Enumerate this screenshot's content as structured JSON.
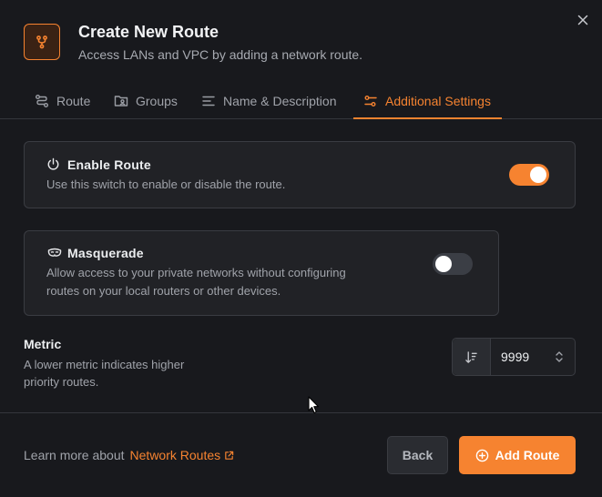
{
  "dialog": {
    "title": "Create New Route",
    "subtitle": "Access LANs and VPC by adding a network route.",
    "header_icon": "route-icon",
    "close_icon": "close-icon"
  },
  "tabs": [
    {
      "label": "Route",
      "icon": "route-icon",
      "active": false
    },
    {
      "label": "Groups",
      "icon": "groups-folder-icon",
      "active": false
    },
    {
      "label": "Name & Description",
      "icon": "text-lines-icon",
      "active": false
    },
    {
      "label": "Additional Settings",
      "icon": "settings-sliders-icon",
      "active": true
    }
  ],
  "enable_route": {
    "title": "Enable Route",
    "description": "Use this switch to enable or disable the route.",
    "icon": "power-icon",
    "enabled": true
  },
  "masquerade": {
    "title": "Masquerade",
    "description_line1": "Allow access to your private networks without configuring",
    "description_line2": "routes on your local routers or other devices.",
    "icon": "mask-icon",
    "enabled": false
  },
  "metric": {
    "title": "Metric",
    "description_line1": "A lower metric indicates higher",
    "description_line2": "priority routes.",
    "value": "9999",
    "prefix_icon": "sort-descending-icon",
    "stepper_icon": "chevron-up-down-icon"
  },
  "footer": {
    "learn_text": "Learn more about",
    "learn_link": "Network Routes",
    "back_label": "Back",
    "add_label": "Add Route"
  },
  "colors": {
    "accent": "#f68330",
    "background": "#18191d",
    "card": "#212226"
  }
}
